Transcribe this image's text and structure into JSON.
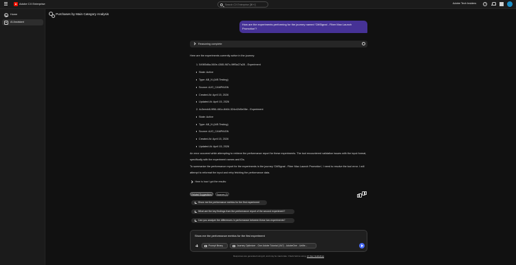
{
  "topbar": {
    "brand": "Adobe CX Enterprise",
    "search_placeholder": "Search CX Enterprise [⌘+/]",
    "org": "Adobe Tech Insiders",
    "avatar_color": "#1a8ec7"
  },
  "sidebar": {
    "items": [
      {
        "label": "Home",
        "icon": "home-icon"
      },
      {
        "label": "AI Assistant",
        "icon": "ai-assistant-icon"
      }
    ]
  },
  "page": {
    "title": "Purchases by Main Category Analysis"
  },
  "conversation": {
    "user_message": "How are the experiments performing for the journey named 'CitiSignal - Fiber Max Launch Promotion'?",
    "user_bubble_color": "#463296",
    "reasoning_label": "Reasoning complete",
    "intro": "Here are the experiments currently active in the journey:",
    "experiments": [
      {
        "title": "1. 54985d6a-560e-4365-987c-9fff5a27a28 - Experiment",
        "details": [
          "State: Active",
          "Type: AB_N (A/B Testing)",
          "Source: AJO_CAMPAIGN",
          "Created At: April 15, 2026",
          "Updated At: April 15, 2026"
        ]
      },
      {
        "title": "2. 4c3eecb8-9f56-461c-8464-324c42d5e06e - Experiment",
        "details": [
          "State: Active",
          "Type: AB_N (A/B Testing)",
          "Source: AJO_CAMPAIGN",
          "Created At: April 15, 2026",
          "Updated At: April 15, 2026"
        ]
      }
    ],
    "error_paragraph": "An error occurred while attempting to retrieve the performance report for these experiments. The tool encountered validation issues with the input format, specifically with the experiment names and IDs.",
    "summary_paragraph": "To summarize the performance report for the experiments in the journey 'CitiSignal - Fiber Max Launch Promotion', I need to resolve the tool error. I will attempt to reformat the input and retry fetching the performance data.",
    "how_got_results": "Here is how I got the results:"
  },
  "tabs": {
    "related": "Related Suggestions",
    "sources": "Sources (2)"
  },
  "suggestions": [
    "Show me the performance metrics for the first experiment",
    "What are the key findings from the performance report of the second experiment?",
    "Can you analyze the differences in performance between these two experiments?"
  ],
  "composer": {
    "value": "Show me the performance metrics for the first experiment",
    "prompt_library": "Prompt library",
    "sandbox": "Journey Optimizer - One Adobe Tutorial (VA7) - AdobeOne - Unifie...",
    "send_color": "#4a6cf7"
  },
  "disclaimer": {
    "text": "Responses are generated using AI, and may be inaccurate. Check before using.",
    "link": "AI User Guidelines"
  }
}
